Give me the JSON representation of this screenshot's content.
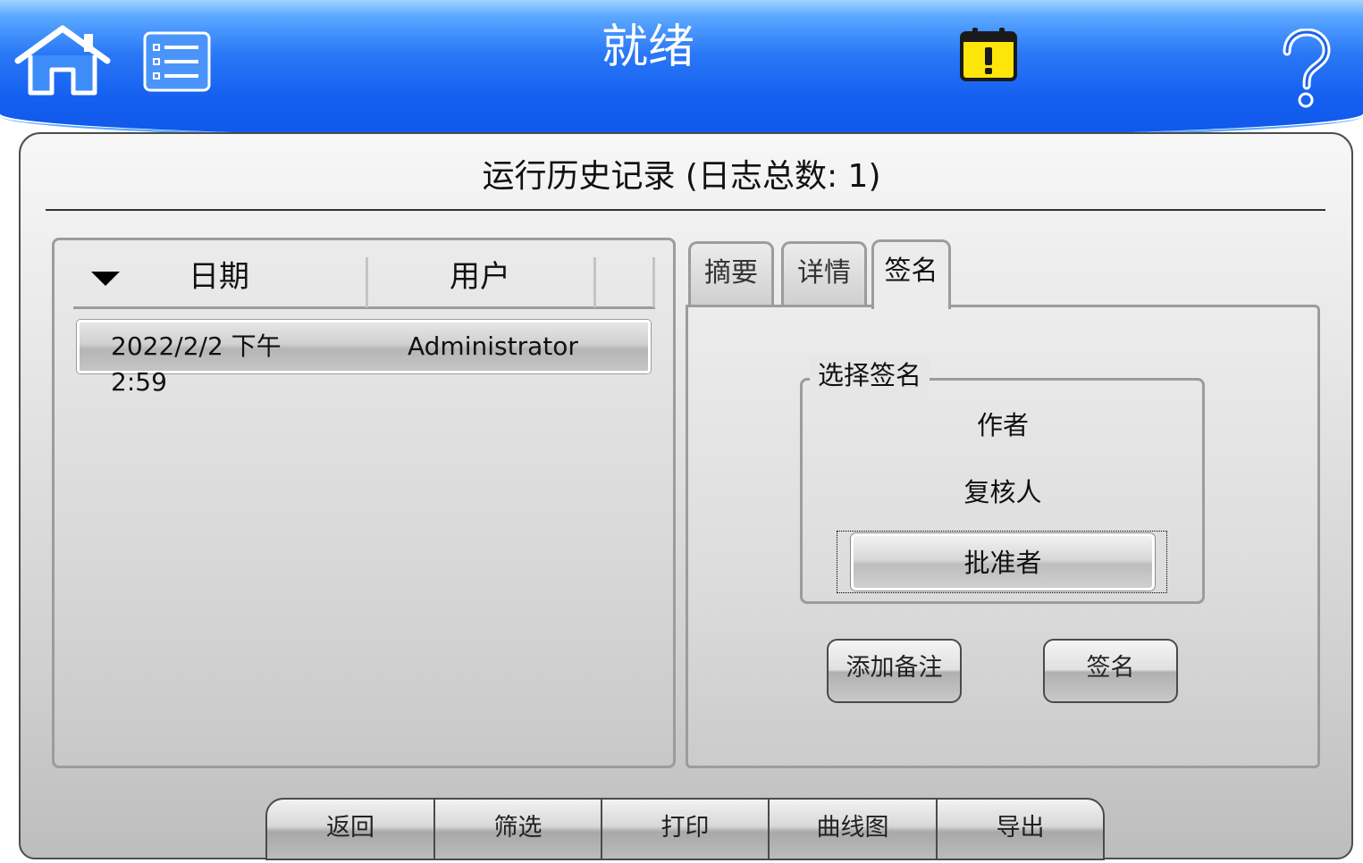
{
  "header": {
    "status_title": "就绪",
    "icons": [
      "home-icon",
      "menu-list-icon",
      "calendar-alert-icon",
      "help-icon"
    ]
  },
  "panel": {
    "title": "运行历史记录 (日志总数: 1)"
  },
  "list": {
    "columns": [
      "日期",
      "用户"
    ],
    "sort_indicator": "sort-descending-icon",
    "rows": [
      {
        "date": "2022/2/2 下午 2:59",
        "user": "Administrator"
      }
    ]
  },
  "tabs": {
    "items": [
      "摘要",
      "详情",
      "签名"
    ],
    "selected": "签名"
  },
  "signature": {
    "group_label": "选择签名",
    "options": [
      "作者",
      "复核人",
      "批准者"
    ],
    "selected": "批准者"
  },
  "actions": {
    "add_note": "添加备注",
    "sign": "签名"
  },
  "bottom_bar": {
    "back": "返回",
    "filter": "筛选",
    "print": "打印",
    "chart": "曲线图",
    "export": "导出"
  },
  "colors": {
    "header_blue": "#155ff0",
    "header_light": "#9fd4ff",
    "alert_yellow": "#ffe60a",
    "panel_gray": "#d8d8d8"
  }
}
